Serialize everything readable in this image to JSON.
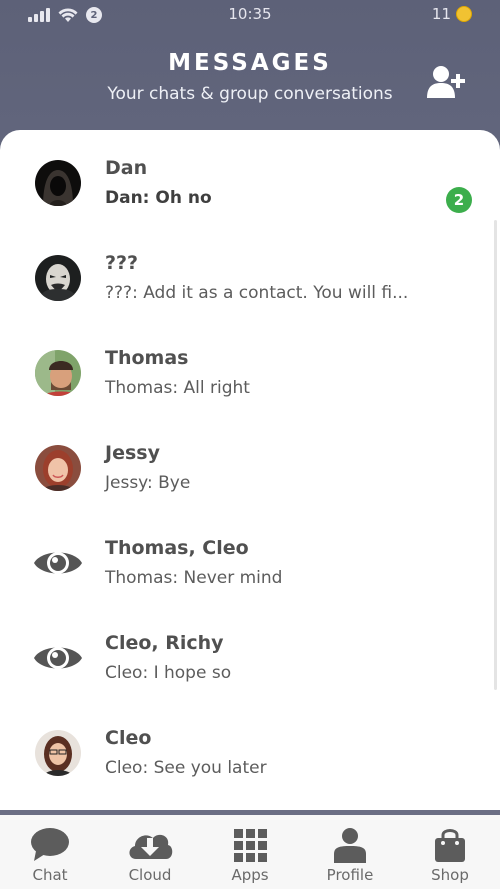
{
  "status": {
    "time": "10:35",
    "notif_count": "2",
    "coins": "11"
  },
  "header": {
    "title": "MESSAGES",
    "subtitle": "Your chats & group conversations",
    "add_icon": "add-user-icon"
  },
  "chats": [
    {
      "name": "Dan",
      "preview": "Dan: Oh no",
      "unread": "2",
      "avatar": "hooded-person"
    },
    {
      "name": "???",
      "preview": "???: Add it as a contact. You will fi...",
      "avatar": "anonymous-mask"
    },
    {
      "name": "Thomas",
      "preview": "Thomas: All right",
      "avatar": "man-beanie"
    },
    {
      "name": "Jessy",
      "preview": "Jessy: Bye",
      "avatar": "woman-red-hair"
    },
    {
      "name": "Thomas, Cleo",
      "preview": "Thomas: Never mind",
      "avatar": "eye-icon"
    },
    {
      "name": "Cleo, Richy",
      "preview": "Cleo: I hope so",
      "avatar": "eye-icon"
    },
    {
      "name": "Cleo",
      "preview": "Cleo: See you later",
      "avatar": "woman-glasses"
    }
  ],
  "tabs": [
    {
      "label": "Chat",
      "icon": "chat-bubble-icon"
    },
    {
      "label": "Cloud",
      "icon": "cloud-download-icon"
    },
    {
      "label": "Apps",
      "icon": "apps-grid-icon"
    },
    {
      "label": "Profile",
      "icon": "profile-icon"
    },
    {
      "label": "Shop",
      "icon": "shopping-bag-icon"
    }
  ],
  "colors": {
    "header": "#5d6178",
    "unread_badge": "#3cae4c",
    "tab_icon": "#5c5c5c"
  }
}
